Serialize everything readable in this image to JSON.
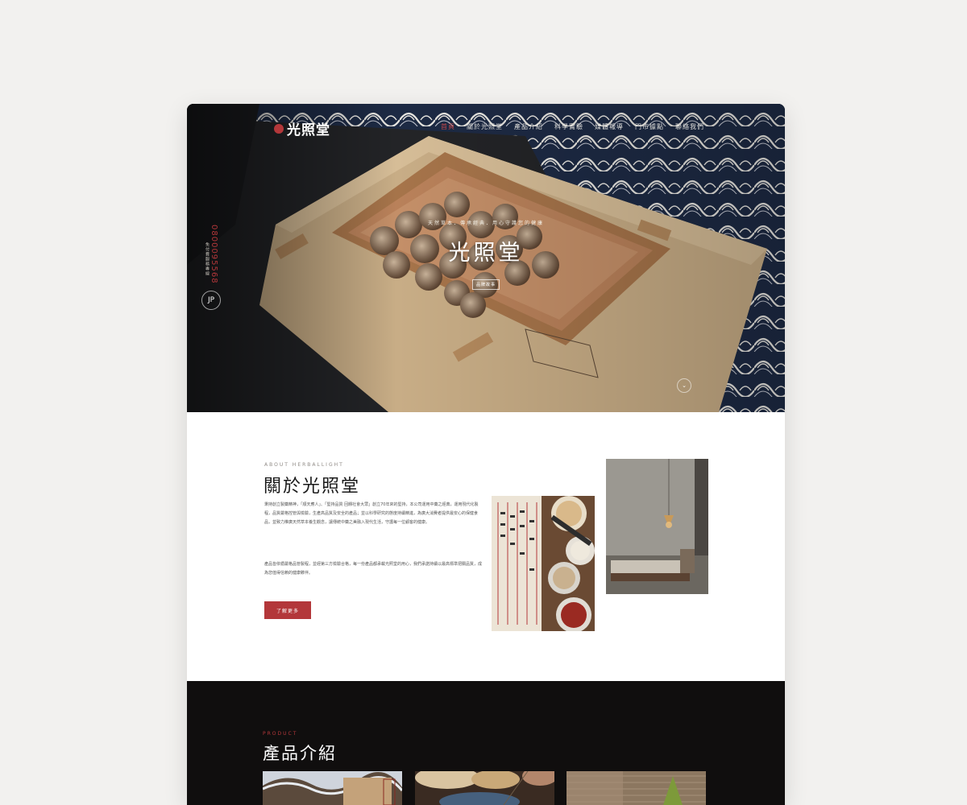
{
  "site": {
    "logo_text": "光照堂",
    "nav": [
      "首頁",
      "關於光照堂",
      "產品介紹",
      "科學實驗",
      "媒體報導",
      "門市據點",
      "聯絡我們"
    ],
    "side_phone": "0800095568",
    "side_label": "免付費服務專線",
    "side_icon": "JP"
  },
  "hero": {
    "subtitle": "天然草本．傳承經典．用心守護您的健康",
    "title": "光照堂",
    "button_label": "品牌故事",
    "scroll_icon": "chevron-down-icon"
  },
  "about": {
    "eyebrow": "ABOUT HERBALLIGHT",
    "title": "關於光照堂",
    "paragraph1": "秉持創立製藥精神，「順天應人」、「堅持品質 回饋社會大眾」創立70年來的堅持，本公司運用中藥之經典，運用現代化製程，品質嚴格控管與檢驗，生產高品質及安全的產品；並以科學研究的態度持續精進，為廣大消費者提供最安心的保健食品，並致力推廣天然草本養生觀念，讓傳統中藥之美融入現代生活，守護每一位顧客的健康。",
    "paragraph2": "產品皆依循嚴格品管製程，並經第三方檢驗合格，每一份產品都承載光照堂的用心，我們承諾持續以最高標準把關品質，成為您值得信賴的健康夥伴。",
    "button_label": "了解更多"
  },
  "products": {
    "eyebrow": "PRODUCT",
    "title": "產品介紹"
  },
  "colors": {
    "accent": "#b3373a",
    "background": "#f2f1ef",
    "dark_section": "#100e0e"
  }
}
